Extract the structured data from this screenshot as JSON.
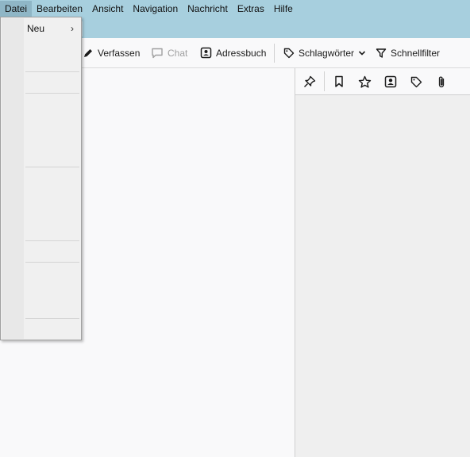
{
  "menubar": {
    "items": [
      {
        "label": "Datei",
        "active": true
      },
      {
        "label": "Bearbeiten"
      },
      {
        "label": "Ansicht"
      },
      {
        "label": "Navigation"
      },
      {
        "label": "Nachricht"
      },
      {
        "label": "Extras"
      },
      {
        "label": "Hilfe"
      }
    ]
  },
  "toolbar": {
    "compose_label": "Verfassen",
    "chat_label": "Chat",
    "addressbook_label": "Adressbuch",
    "tags_label": "Schlagwörter",
    "quickfilter_label": "Schnellfilter"
  },
  "file_menu": {
    "new_label": "Neu",
    "new_arrow": "›"
  },
  "column_icons": [
    "thread-pin-icon",
    "bookmark-icon",
    "star-icon",
    "contact-icon",
    "tag-icon",
    "attachment-icon"
  ],
  "colors": {
    "titlebar": "#a7cfde",
    "menu_active": "#8fb6c6"
  }
}
